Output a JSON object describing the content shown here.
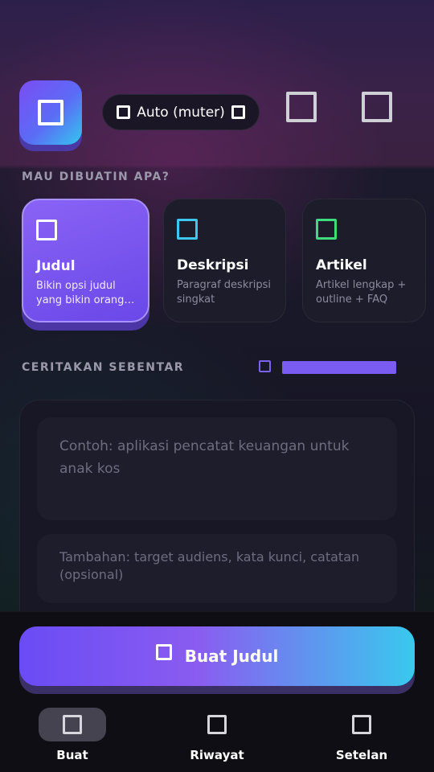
{
  "header": {
    "logo_icon": "app-logo-icon",
    "mode_selector": {
      "left_icon": "mode-icon",
      "label": "Auto (muter)",
      "right_icon": "mode-toggle-icon"
    },
    "actions": [
      "history-icon",
      "menu-icon"
    ]
  },
  "type_section": {
    "label": "MAU DIBUATIN APA?",
    "cards": [
      {
        "icon": "title-type-icon",
        "icon_color": "#ffffff",
        "title": "Judul",
        "desc": "Bikin opsi judul yang bikin orang penasaran",
        "active": true
      },
      {
        "icon": "description-type-icon",
        "icon_color": "#3ec8f0",
        "title": "Deskripsi",
        "desc": "Paragraf deskripsi singkat",
        "active": false
      },
      {
        "icon": "article-type-icon",
        "icon_color": "#3fdc7e",
        "title": "Artikel",
        "desc": "Artikel lengkap + outline + FAQ",
        "active": false
      }
    ]
  },
  "story_section": {
    "label": "CERITAKAN SEBENTAR",
    "progress_icon": "progress-icon",
    "progress_fraction": 1.0,
    "accent_color": "#7a5cf2"
  },
  "inputs": {
    "main_placeholder": "Contoh: aplikasi pencatat keuangan untuk anak kos",
    "extra_placeholder": "Tambahan: target audiens, kata kunci, catatan (opsional)"
  },
  "cta": {
    "icon": "sparkle-icon",
    "label": "Buat Judul"
  },
  "bottom_nav": [
    {
      "icon": "create-icon",
      "label": "Buat",
      "active": true
    },
    {
      "icon": "history-icon",
      "label": "Riwayat",
      "active": false
    },
    {
      "icon": "settings-icon",
      "label": "Setelan",
      "active": false
    }
  ]
}
